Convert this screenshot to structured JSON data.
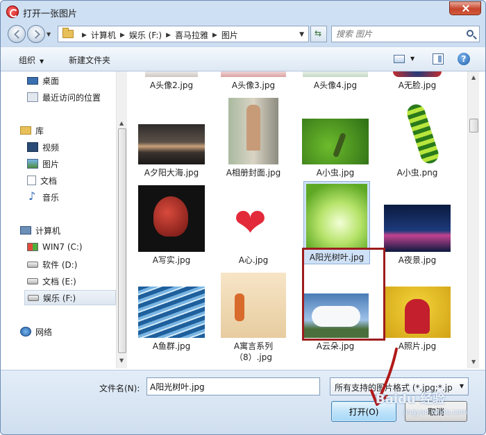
{
  "window": {
    "title": "打开一张图片"
  },
  "address": {
    "crumbs": [
      "计算机",
      "娱乐 (F:)",
      "喜马拉雅",
      "图片"
    ]
  },
  "search": {
    "placeholder": "搜索 图片"
  },
  "toolbar": {
    "organize": "组织",
    "new_folder": "新建文件夹"
  },
  "nav": {
    "items": [
      {
        "label": "桌面",
        "icon": "desktop-icon"
      },
      {
        "label": "最近访问的位置",
        "icon": "recent-places-icon"
      },
      {
        "label": "库",
        "icon": "library-icon"
      },
      {
        "label": "视频",
        "icon": "video-icon"
      },
      {
        "label": "图片",
        "icon": "pictures-icon"
      },
      {
        "label": "文档",
        "icon": "documents-icon"
      },
      {
        "label": "音乐",
        "icon": "music-icon"
      },
      {
        "label": "计算机",
        "icon": "computer-icon"
      },
      {
        "label": "WIN7 (C:)",
        "icon": "windows-drive-icon"
      },
      {
        "label": "软件 (D:)",
        "icon": "drive-icon"
      },
      {
        "label": "文档 (E:)",
        "icon": "drive-icon"
      },
      {
        "label": "娱乐 (F:)",
        "icon": "drive-icon",
        "selected": true
      },
      {
        "label": "网络",
        "icon": "network-icon"
      }
    ]
  },
  "files": [
    "A头像2.jpg",
    "A头像3.jpg",
    "A头像4.jpg",
    "A无脸.jpg",
    "A夕阳大海.jpg",
    "A相册封面.jpg",
    "A小虫.jpg",
    "A小虫.png",
    "A写实.jpg",
    "A心.jpg",
    "A阳光树叶.jpg",
    "A夜景.jpg",
    "A鱼群.jpg",
    "A寓言系列（8）.jpg",
    "A云朵.jpg",
    "A照片.jpg"
  ],
  "selected_file": "A阳光树叶.jpg",
  "bottom": {
    "filename_label": "文件名(N):",
    "filename_value": "A阳光树叶.jpg",
    "filetype": "所有支持的图片格式 (*.jpg;*.jp",
    "open_label": "打开(O)",
    "cancel_label": "取消"
  },
  "watermark": {
    "main": "Baidu 经验",
    "sub": "jingyan.baidu.com"
  },
  "colors": {
    "highlight": "#9c1c1c",
    "accent": "#3c7fb1"
  }
}
